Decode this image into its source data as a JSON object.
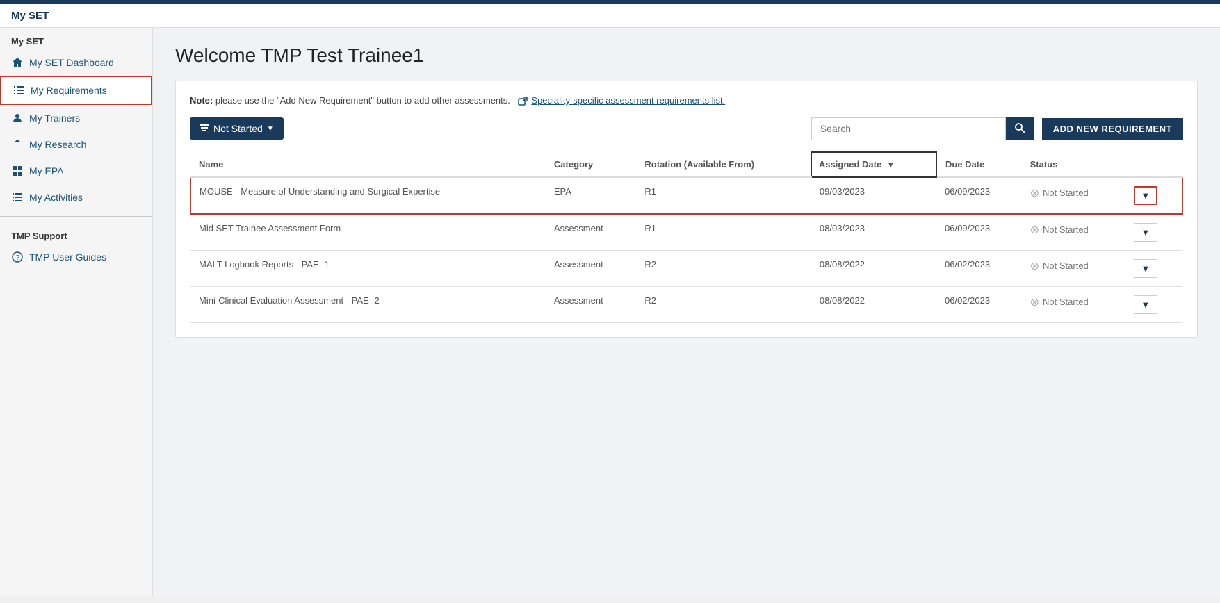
{
  "app": {
    "top_brand": "My SET"
  },
  "sidebar": {
    "section1": "My SET",
    "items": [
      {
        "id": "dashboard",
        "label": "My SET Dashboard",
        "icon": "home",
        "active": false
      },
      {
        "id": "requirements",
        "label": "My Requirements",
        "icon": "list",
        "active": true
      },
      {
        "id": "trainers",
        "label": "My Trainers",
        "icon": "user",
        "active": false
      },
      {
        "id": "research",
        "label": "My Research",
        "icon": "upload",
        "active": false
      },
      {
        "id": "epa",
        "label": "My EPA",
        "icon": "grid",
        "active": false
      },
      {
        "id": "activities",
        "label": "My Activities",
        "icon": "list2",
        "active": false
      }
    ],
    "section2": "TMP Support",
    "support_items": [
      {
        "id": "user-guides",
        "label": "TMP User Guides",
        "icon": "question"
      }
    ]
  },
  "main": {
    "page_title": "Welcome TMP Test Trainee1",
    "note_prefix": "Note:",
    "note_text": " please use the \"Add New Requirement\" button to add other assessments.",
    "note_link": "Speciality-specific assessment requirements list.",
    "toolbar": {
      "filter_label": "Not Started",
      "search_placeholder": "Search",
      "add_button_label": "ADD NEW REQUIREMENT"
    },
    "table": {
      "columns": [
        "Name",
        "Category",
        "Rotation (Available From)",
        "Assigned Date",
        "Due Date",
        "Status",
        ""
      ],
      "sorted_col": "Assigned Date",
      "rows": [
        {
          "name": "MOUSE - Measure of Understanding and Surgical Expertise",
          "category": "EPA",
          "rotation": "R1",
          "assigned_date": "09/03/2023",
          "due_date": "06/09/2023",
          "status": "Not Started",
          "highlighted": true
        },
        {
          "name": "Mid SET Trainee Assessment Form",
          "category": "Assessment",
          "rotation": "R1",
          "assigned_date": "08/03/2023",
          "due_date": "06/09/2023",
          "status": "Not Started",
          "highlighted": false
        },
        {
          "name": "MALT Logbook Reports - PAE -1",
          "category": "Assessment",
          "rotation": "R2",
          "assigned_date": "08/08/2022",
          "due_date": "06/02/2023",
          "status": "Not Started",
          "highlighted": false
        },
        {
          "name": "Mini-Clinical Evaluation Assessment - PAE -2",
          "category": "Assessment",
          "rotation": "R2",
          "assigned_date": "08/08/2022",
          "due_date": "06/02/2023",
          "status": "Not Started",
          "highlighted": false
        }
      ]
    }
  }
}
